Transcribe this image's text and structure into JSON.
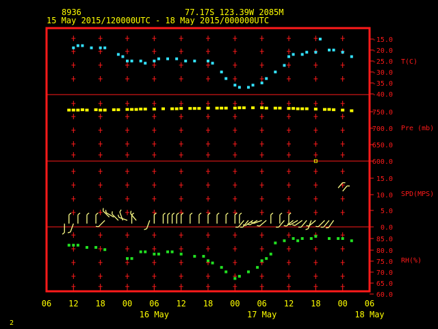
{
  "header": {
    "station": "8936",
    "location": "77.17S  123.39W  2085M",
    "period": "15 May 2015/120000UTC - 18 May 2015/000000UTC"
  },
  "footer": {
    "page": "2"
  },
  "colors": {
    "frame": "#ff1a1a",
    "labels": "#ff1a1a",
    "header_text": "#ffff00",
    "temperature": "#33e0ff",
    "pressure": "#ffff00",
    "wind": "#ffff88",
    "humidity": "#22e022",
    "background": "#000000"
  },
  "chart_data": {
    "type": "scatter",
    "x_unit": "hour offset from 15 May 2015 12 UTC",
    "x_range": [
      -6,
      66
    ],
    "x_ticks": [
      "06",
      "12",
      "18",
      "00",
      "06",
      "12",
      "18",
      "00",
      "06",
      "12",
      "18",
      "00",
      "06"
    ],
    "x_day_labels": [
      "16 May",
      "17 May",
      "18 May"
    ],
    "panels": [
      {
        "id": "temperature",
        "ylabel": "T(C)",
        "ticks": [
          "-15.0",
          "-20.0",
          "-25.0",
          "-30.0",
          "-35.0",
          "-40.0"
        ],
        "ylim": [
          -40,
          -15
        ],
        "series": {
          "x": [
            0,
            1,
            2,
            4,
            6,
            7,
            10,
            11,
            12,
            13,
            15,
            16,
            18,
            19,
            21,
            23,
            25,
            27,
            30,
            31,
            33,
            34,
            36,
            37,
            39,
            40,
            42,
            43,
            45,
            47,
            48,
            49,
            51,
            52,
            54,
            55,
            57,
            58,
            60,
            62
          ],
          "y": [
            -19,
            -18,
            -18,
            -19,
            -19,
            -19,
            -22,
            -23,
            -25,
            -25,
            -25,
            -26,
            -25,
            -24,
            -24,
            -24,
            -25,
            -25,
            -25,
            -26,
            -30,
            -33,
            -36,
            -37,
            -37,
            -36,
            -35,
            -33,
            -30,
            -27,
            -23,
            -22,
            -22,
            -21,
            -21,
            -15,
            -20,
            -20,
            -21,
            -23
          ]
        }
      },
      {
        "id": "pressure",
        "ylabel": "Pre (mb)",
        "ticks": [
          "750.0",
          "700.0",
          "650.0",
          "600.0"
        ],
        "ylim": [
          600,
          780
        ],
        "series": {
          "x": [
            -1,
            0,
            1,
            2,
            3,
            5,
            6,
            7,
            9,
            10,
            12,
            13,
            14,
            15,
            16,
            18,
            20,
            22,
            23,
            24,
            26,
            27,
            28,
            30,
            32,
            33,
            34,
            36,
            37,
            38,
            40,
            42,
            43,
            45,
            46,
            48,
            49,
            50,
            51,
            52,
            54,
            56,
            57,
            58,
            60,
            62
          ],
          "y": [
            755,
            755,
            755,
            756,
            755,
            756,
            755,
            755,
            756,
            756,
            757,
            757,
            757,
            758,
            758,
            758,
            759,
            759,
            759,
            760,
            760,
            760,
            760,
            761,
            761,
            761,
            761,
            761,
            762,
            762,
            762,
            762,
            761,
            761,
            761,
            760,
            760,
            759,
            759,
            759,
            758,
            757,
            757,
            756,
            755,
            753
          ]
        },
        "outlier": {
          "x": 54,
          "y": 600
        }
      },
      {
        "id": "wind",
        "ylabel": "SPD(MPS)",
        "ticks": [
          "15.0",
          "10.0",
          "5.0",
          "0.0"
        ],
        "ylim": [
          0,
          17
        ],
        "barbs": {
          "x": [
            -2,
            -1,
            0,
            1,
            3,
            5,
            7,
            8,
            9,
            10,
            11,
            12,
            13,
            14,
            17,
            18,
            20,
            21,
            22,
            23,
            24,
            26,
            28,
            30,
            32,
            34,
            36,
            37,
            38,
            39,
            40,
            41,
            42,
            43,
            44,
            46,
            47,
            48,
            49,
            50,
            51,
            52,
            53,
            54,
            56,
            57,
            58,
            59,
            60
          ],
          "dir": [
            180,
            0,
            200,
            0,
            0,
            0,
            225,
            315,
            300,
            315,
            340,
            290,
            0,
            320,
            200,
            0,
            0,
            0,
            0,
            0,
            0,
            0,
            0,
            0,
            0,
            0,
            0,
            0,
            220,
            220,
            235,
            240,
            250,
            230,
            0,
            0,
            220,
            0,
            230,
            240,
            235,
            220,
            200,
            230,
            225,
            220,
            215,
            40,
            40
          ],
          "spd": [
            1,
            1,
            1,
            1,
            1,
            1,
            2,
            3,
            3,
            2,
            2,
            2,
            1,
            2,
            2,
            1,
            1,
            1,
            1,
            1,
            1,
            1,
            1,
            1,
            1,
            1,
            1,
            1,
            2,
            2,
            2,
            2,
            2,
            2,
            1,
            1,
            2,
            1,
            2,
            2,
            2,
            2,
            2,
            2,
            2,
            2,
            2,
            12,
            11
          ]
        }
      },
      {
        "id": "humidity",
        "ylabel": "RH(%)",
        "ticks": [
          "85.0",
          "80.0",
          "75.0",
          "70.0",
          "65.0",
          "60.0"
        ],
        "ylim": [
          60,
          90
        ],
        "series": {
          "x": [
            -1,
            0,
            1,
            3,
            5,
            7,
            12,
            13,
            15,
            16,
            18,
            19,
            21,
            22,
            24,
            27,
            29,
            30,
            31,
            33,
            34,
            36,
            37,
            39,
            41,
            42,
            43,
            44,
            45,
            47,
            49,
            50,
            51,
            53,
            54,
            57,
            59,
            60,
            62
          ],
          "y": [
            82,
            82,
            82,
            81,
            81,
            80,
            76,
            76,
            79,
            79,
            78,
            78,
            79,
            79,
            78,
            77,
            77,
            75,
            74,
            72,
            70,
            67,
            68,
            70,
            72,
            75,
            76,
            78,
            83,
            84,
            85,
            84,
            85,
            85,
            86,
            85,
            85,
            85,
            84
          ]
        }
      }
    ],
    "grid": true,
    "legend": "none"
  }
}
